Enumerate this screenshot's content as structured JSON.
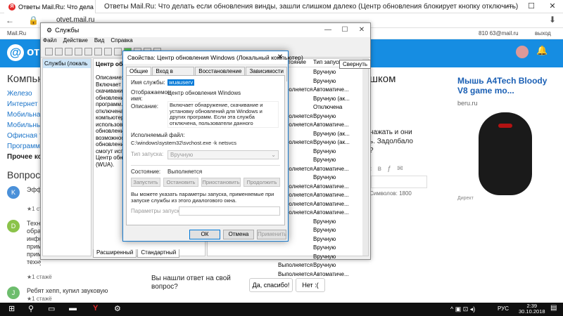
{
  "browser": {
    "tab_title": "Ответы Mail.Ru: Что дела",
    "window_title": "Ответы Mail.Ru: Что делать если обновления винды, зашли слишком далеко (Центр обновления блокирует кнопку отключить)",
    "url": "otvet.mail.ru",
    "bookmarks_left": "Mail.Ru",
    "bookmarks_right": "810 63@mail.ru",
    "exit": "выход",
    "logo_text": "отве"
  },
  "page": {
    "heading": "Компьют",
    "categories": [
      "Железо",
      "Интернет",
      "Мобильная",
      "Мобильные",
      "Офисная т",
      "Программ",
      "Прочее ко"
    ],
    "questions_heading": "Вопросы",
    "questions": [
      {
        "initial": "K",
        "text": "Эфф",
        "rating": "★1 стажё",
        "color": "#4a90d9"
      },
      {
        "initial": "D",
        "text": "Техн обра инфо прим прим технуми",
        "rating": "★1 стажё",
        "color": "#8bc34a"
      },
      {
        "initial": "J",
        "text": "Ребят хепп, купил звуковую",
        "rating": "★1 стажё",
        "color": "#6dbd6d"
      }
    ],
    "main_title": "шком",
    "main_text1": "нажать и они",
    "main_text2": "ь. Задолбало",
    "main_text3": "?",
    "symbols": "Символов: 1800",
    "bottom_question": "Вы нашли ответ на свой вопрос?",
    "yes_button": "Да, спасибо!",
    "no_button": "Нет :("
  },
  "ad": {
    "title": "Мышь A4Tech Bloody V8 game mo...",
    "url": "beru.ru",
    "label": "Директ"
  },
  "services": {
    "title": "Службы",
    "menu": [
      "Файл",
      "Действие",
      "Вид",
      "Справка"
    ],
    "tree_label": "Службы (локаль",
    "desc_header": "Центр обнов",
    "desc_lines": [
      "Описание:",
      "Включает об",
      "скачивание",
      "обновлений д",
      "программ. Е",
      "отключена, п",
      "компьютеров",
      "использоват",
      "обновлений",
      "возможности",
      "обновления",
      "смогут испо",
      "Центр обно",
      "(WUA)."
    ],
    "col_state": "Состояние",
    "col_start": "Тип запуска",
    "rows": [
      {
        "state": "",
        "start": "Вручную"
      },
      {
        "state": "",
        "start": "Вручную"
      },
      {
        "state": "Выполняется",
        "start": "Автоматиче..."
      },
      {
        "state": "",
        "start": "Вручную (ак..."
      },
      {
        "state": "",
        "start": "Отключена"
      },
      {
        "state": "Выполняется",
        "start": "Вручную"
      },
      {
        "state": "Выполняется",
        "start": "Автоматиче..."
      },
      {
        "state": "",
        "start": "Вручную (ак..."
      },
      {
        "state": "Выполняется",
        "start": "Вручную (ак..."
      },
      {
        "state": "",
        "start": "Вручную"
      },
      {
        "state": "",
        "start": "Вручную"
      },
      {
        "state": "Выполняется",
        "start": "Автоматиче..."
      },
      {
        "state": "",
        "start": "Вручную"
      },
      {
        "state": "Выполняется",
        "start": "Автоматиче..."
      },
      {
        "state": "Выполняется",
        "start": "Автоматиче..."
      },
      {
        "state": "Выполняется",
        "start": "Автоматиче..."
      },
      {
        "state": "Выполняется",
        "start": "Автоматиче..."
      },
      {
        "state": "",
        "start": "Вручную"
      },
      {
        "state": "",
        "start": "Вручную"
      },
      {
        "state": "",
        "start": "Вручную"
      },
      {
        "state": "",
        "start": "Вручную"
      },
      {
        "state": "",
        "start": "Вручную"
      },
      {
        "state": "Выполняется",
        "start": "Вручную"
      },
      {
        "state": "Выполняется",
        "start": "Автоматиче..."
      }
    ],
    "tab_extended": "Расширенный",
    "tab_standard": "Стандартный",
    "tooltip": "Свернуть"
  },
  "dialog": {
    "title": "Свойства: Центр обновления Windows (Локальный компьютер)",
    "tabs": [
      "Общие",
      "Вход в систему",
      "Восстановление",
      "Зависимости"
    ],
    "service_name_label": "Имя службы:",
    "service_name": "wuauserv",
    "display_name_label": "Отображаемое имя:",
    "display_name": "Центр обновления Windows",
    "description_label": "Описание:",
    "description": "Включает обнаружение, скачивание и установку обновлений для Windows и других программ. Если эта служба отключена, пользователи данного компьютера не смогут использовать",
    "exe_label": "Исполняемый файл:",
    "exe_path": "C:\\windows\\system32\\svchost.exe -k netsvcs",
    "startup_label": "Тип запуска:",
    "startup_value": "Вручную",
    "status_label": "Состояние:",
    "status_value": "Выполняется",
    "btn_start": "Запустить",
    "btn_stop": "Остановить",
    "btn_pause": "Приостановить",
    "btn_resume": "Продолжить",
    "params_note": "Вы можете указать параметры запуска, применяемые при запуске службы из этого диалогового окна.",
    "params_label": "Параметры запуска:",
    "ok": "ОК",
    "cancel": "Отмена",
    "apply": "Применить"
  },
  "taskbar": {
    "lang": "РУС",
    "time": "2:39",
    "date": "30.10.2018"
  }
}
